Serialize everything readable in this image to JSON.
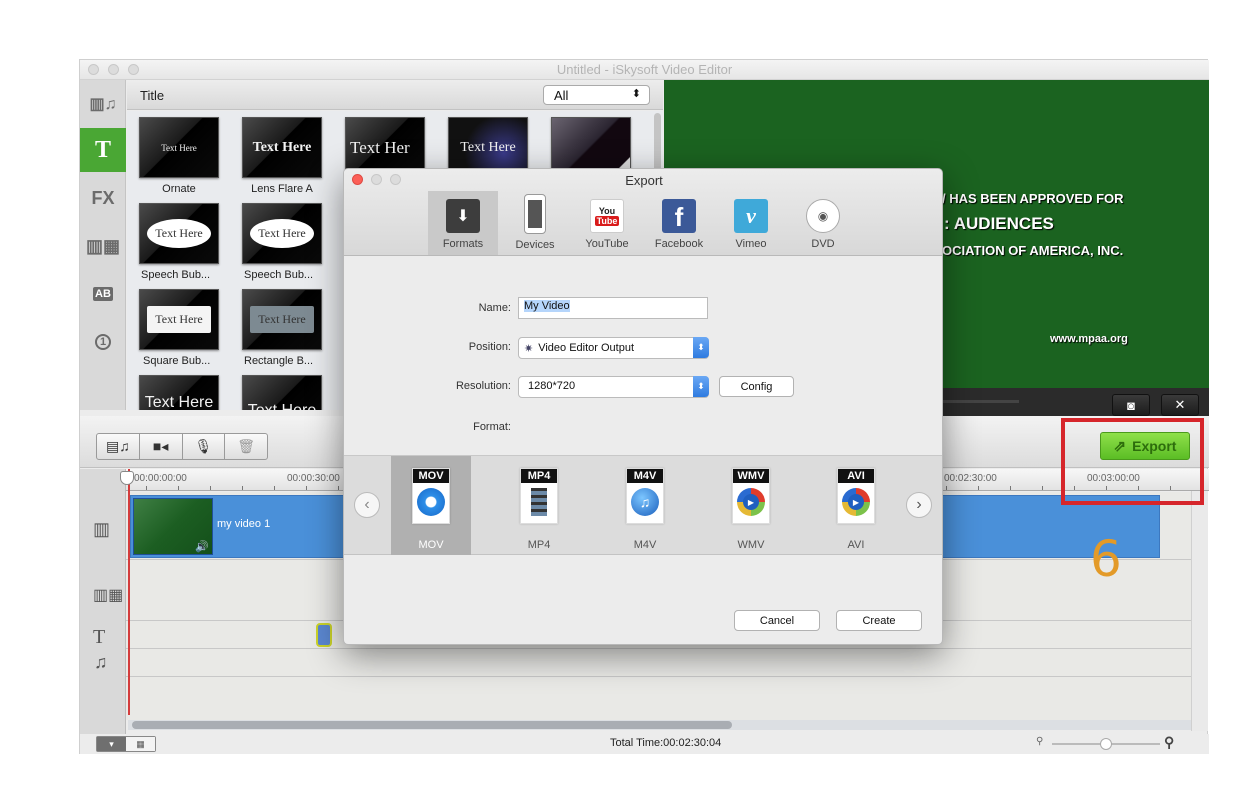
{
  "window": {
    "title": "Untitled - iSkysoft Video Editor"
  },
  "sidebar": {
    "items": [
      {
        "name": "media",
        "label": "♫",
        "active": false
      },
      {
        "name": "text",
        "label": "T",
        "active": true
      },
      {
        "name": "effects",
        "label": "FX",
        "active": false
      },
      {
        "name": "transitions",
        "label": "▦",
        "active": false
      },
      {
        "name": "intro-credit",
        "label": "AB",
        "active": false
      },
      {
        "name": "countdown",
        "label": "1",
        "active": false
      }
    ]
  },
  "title_panel": {
    "heading": "Title",
    "filter": {
      "selected": "All"
    },
    "items": [
      {
        "label": "Ornate",
        "preview_text": "Text Here"
      },
      {
        "label": "Lens Flare A",
        "preview_text": "Text Here"
      },
      {
        "label": "",
        "preview_text": "Text Her"
      },
      {
        "label": "",
        "preview_text": "Text Here"
      },
      {
        "label": "",
        "preview_text": ""
      },
      {
        "label": "Speech Bub...",
        "preview_text": "Text Here"
      },
      {
        "label": "Speech Bub...",
        "preview_text": "Text Here"
      },
      {
        "label": "Square Bub...",
        "preview_text": "Text Here"
      },
      {
        "label": "Rectangle B...",
        "preview_text": "Text Here"
      },
      {
        "label": "",
        "preview_text": "Text Here"
      },
      {
        "label": "",
        "preview_text": "Text Here"
      }
    ]
  },
  "preview": {
    "lines": [
      "/ HAS BEEN APPROVED FOR",
      ": AUDIENCES",
      "OCIATION OF AMERICA, INC."
    ],
    "url": "www.mpaa.org",
    "snapshot_icon": "camera-icon",
    "fullscreen_icon": "expand-icon"
  },
  "toolbar": {
    "tools": [
      "media-icon",
      "camera-icon",
      "microphone-icon",
      "trash-icon"
    ],
    "export_label": "Export"
  },
  "timeline": {
    "ruler_labels": [
      "00:00:00:00",
      "00:00:30:00",
      "00:02:30:00",
      "00:03:00:00"
    ],
    "clip": {
      "label": "my video 1"
    }
  },
  "status": {
    "total_time": "Total Time:00:02:30:04",
    "zoom_level": 0.5
  },
  "annotation": {
    "step_number": "6",
    "highlight_color": "#d6262b"
  },
  "export_dialog": {
    "title": "Export",
    "tabs": [
      {
        "label": "Formats",
        "selected": true
      },
      {
        "label": "Devices",
        "selected": false
      },
      {
        "label": "YouTube",
        "selected": false
      },
      {
        "label": "Facebook",
        "selected": false
      },
      {
        "label": "Vimeo",
        "selected": false
      },
      {
        "label": "DVD",
        "selected": false
      }
    ],
    "name_label": "Name:",
    "name_value": "My Video",
    "position_label": "Position:",
    "position_value": "Video Editor Output",
    "resolution_label": "Resolution:",
    "resolution_value": "1280*720",
    "config_label": "Config",
    "format_label": "Format:",
    "formats": [
      {
        "badge": "MOV",
        "label": "MOV",
        "selected": true
      },
      {
        "badge": "MP4",
        "label": "MP4",
        "selected": false
      },
      {
        "badge": "M4V",
        "label": "M4V",
        "selected": false
      },
      {
        "badge": "WMV",
        "label": "WMV",
        "selected": false
      },
      {
        "badge": "AVI",
        "label": "AVI",
        "selected": false
      }
    ],
    "cancel_label": "Cancel",
    "create_label": "Create"
  },
  "colors": {
    "accent_green": "#4aa734",
    "export_green": "#6fcb30",
    "preview_bg": "#1b6320",
    "selection_blue": "#4a90d9"
  }
}
